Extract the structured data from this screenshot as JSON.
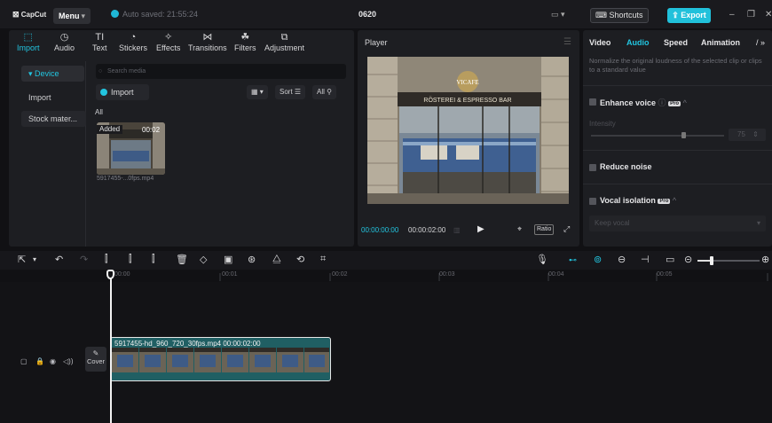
{
  "titlebar": {
    "logo": "CapCut",
    "menu_label": "Menu",
    "autosave_text": "Auto saved: 21:55:24",
    "project_title": "0620",
    "shortcuts_label": "Shortcuts",
    "export_label": "Export"
  },
  "tool_tabs": [
    {
      "label": "Import",
      "icon": "import-icon",
      "active": true
    },
    {
      "label": "Audio",
      "icon": "audio-icon"
    },
    {
      "label": "Text",
      "icon": "text-icon"
    },
    {
      "label": "Stickers",
      "icon": "sticker-icon"
    },
    {
      "label": "Effects",
      "icon": "effects-icon"
    },
    {
      "label": "Transitions",
      "icon": "transitions-icon"
    },
    {
      "label": "Filters",
      "icon": "filters-icon"
    },
    {
      "label": "Adjustment",
      "icon": "adjustment-icon"
    }
  ],
  "media": {
    "side_items": [
      "Device",
      "Import",
      "Stock mater..."
    ],
    "search_placeholder": "Search media",
    "import_label": "Import",
    "sort_label": "Sort",
    "all_filter_label": "All",
    "section_label": "All",
    "clip_added_badge": "Added",
    "clip_duration": "00:02",
    "clip_filename": "5917455-...0fps.mp4"
  },
  "player": {
    "title": "Player",
    "current_time": "00:00:00:00",
    "total_time": "00:00:02:00",
    "ratio_label": "Ratio",
    "scene_sign": "RÖSTEREI & ESPRESSO BAR",
    "scene_logo": "VICAFE"
  },
  "properties": {
    "tabs": [
      "Video",
      "Audio",
      "Speed",
      "Animation"
    ],
    "active_tab": "Audio",
    "description": "Normalize the original loudness of the selected clip or clips to a standard value",
    "enhance_voice_label": "Enhance voice",
    "pro_badge": "Pro",
    "intensity_label": "Intensity",
    "intensity_value": "75",
    "reduce_noise_label": "Reduce noise",
    "vocal_isolation_label": "Vocal isolation",
    "keep_vocal_label": "Keep vocal"
  },
  "timeline": {
    "ruler_labels": [
      "00:00",
      "00:01",
      "00:02",
      "00:03",
      "00:04",
      "00:05"
    ],
    "cover_label": "Cover",
    "clip_label": "5917455-hd_960_720_30fps.mp4  00:00:02:00"
  },
  "colors": {
    "accent": "#22c5e0",
    "clip": "#205f63",
    "panel": "#1d1e22"
  }
}
